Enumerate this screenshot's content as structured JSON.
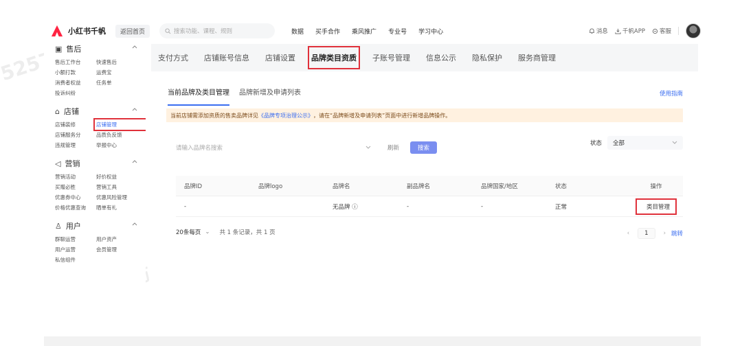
{
  "topbar": {
    "app_name": "小红书千帆",
    "back_home": "返回首页",
    "search_placeholder": "搜索功能、课程、规则",
    "nav": [
      "数据",
      "买手合作",
      "乘风推广",
      "专业号",
      "学习中心"
    ],
    "messages": "消息",
    "app_download": "千帆APP",
    "service": "客服"
  },
  "sidebar": {
    "sections": [
      {
        "title": "售后",
        "icon": "after-sales-icon",
        "items": [
          "售后工作台",
          "快速售后",
          "小额打款",
          "运费宝",
          "消费者权益",
          "任务单",
          "投诉纠纷"
        ]
      },
      {
        "title": "店铺",
        "icon": "store-icon",
        "items": [
          "店铺装修",
          "店铺管理",
          "店铺服务分",
          "品质负反馈",
          "违规管理",
          "举报中心"
        ],
        "active": "店铺管理"
      },
      {
        "title": "营销",
        "icon": "marketing-icon",
        "items": [
          "营销活动",
          "好价权益",
          "买赠必胜",
          "营销工具",
          "优惠券中心",
          "优惠风险管理",
          "价格优惠查询",
          "晒单有礼"
        ]
      },
      {
        "title": "用户",
        "icon": "user-icon",
        "items": [
          "群聊运营",
          "用户资产",
          "用户运营",
          "会员管理",
          "私信组件"
        ]
      }
    ]
  },
  "main": {
    "tabs": [
      "支付方式",
      "店铺账号信息",
      "店铺设置",
      "品牌类目资质",
      "子账号管理",
      "信息公示",
      "隐私保护",
      "服务商管理"
    ],
    "active_tab": "品牌类目资质",
    "subtabs": [
      "当前品牌及类目管理",
      "品牌新增及申请列表"
    ],
    "guide_link": "使用指南",
    "notice_prefix": "当前店铺需添加资质的售卖品牌详见",
    "notice_link": "《品牌专项治理公示》",
    "notice_suffix": "，请在“品牌新增及申请列表”页面中进行新增品牌操作。",
    "filter": {
      "brand_placeholder": "请输入品牌名搜索",
      "refresh": "刷新",
      "search": "搜索",
      "status_label": "状态",
      "status_value": "全部"
    },
    "table": {
      "headers": [
        "品牌ID",
        "品牌logo",
        "品牌名",
        "副品牌名",
        "品牌国家/地区",
        "状态",
        "操作"
      ],
      "rows": [
        {
          "id": "-",
          "logo": "",
          "name": "无品牌 ⓘ",
          "sub_name": "-",
          "country": "-",
          "status": "正常",
          "action": "类目管理"
        }
      ]
    },
    "pager": {
      "page_size": "20条每页",
      "total": "共 1 条记录，共 1 页",
      "current": "1",
      "jump": "跳转"
    }
  },
  "colors": {
    "accent": "#3a6df0",
    "highlight": "#e0303a",
    "brand": "#ff2442",
    "notice_bg": "#fff1e0"
  }
}
